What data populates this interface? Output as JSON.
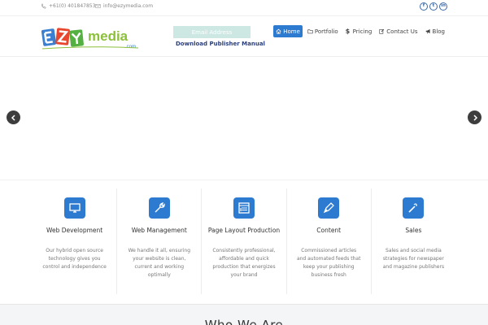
{
  "topbar": {
    "phone": "+61(0) 401847853",
    "email": "info@ezymedia.com",
    "social": [
      "f",
      "t",
      "in"
    ]
  },
  "header": {
    "logo_text": "media",
    "logo_sub": ".com",
    "email_placeholder": "Email Address",
    "publisher_link": "Download Publisher Manual",
    "nav": [
      {
        "label": "Home",
        "icon": "home-icon",
        "active": true
      },
      {
        "label": "Portfolio",
        "icon": "folder-icon",
        "active": false
      },
      {
        "label": "Pricing",
        "icon": "dollar-icon",
        "active": false
      },
      {
        "label": "Contact Us",
        "icon": "edit-icon",
        "active": false
      },
      {
        "label": "Blog",
        "icon": "bullhorn-icon",
        "active": false
      }
    ]
  },
  "services": [
    {
      "title": "Web Development",
      "desc": "Our hybrid open source technology gives you control and independence",
      "icon": "monitor-icon"
    },
    {
      "title": "Web Management",
      "desc": "We handle it all, ensuring your website is clean, current and working optimally",
      "icon": "wrench-icon"
    },
    {
      "title": "Page Layout Production",
      "desc": "Consistently professional, affordable and quick production that energizes your brand",
      "icon": "layout-icon"
    },
    {
      "title": "Content",
      "desc": "Commissioned articles and automated feeds that keep your publishing business fresh",
      "icon": "pen-icon"
    },
    {
      "title": "Sales",
      "desc": "Sales and social media strategies for newspaper and magazine publishers",
      "icon": "magic-wand-icon"
    }
  ],
  "who": {
    "title": "Who We Are"
  },
  "colors": {
    "accent": "#2c7bd0",
    "email_box": "#cde8e3",
    "publisher": "#2b3f7a"
  }
}
